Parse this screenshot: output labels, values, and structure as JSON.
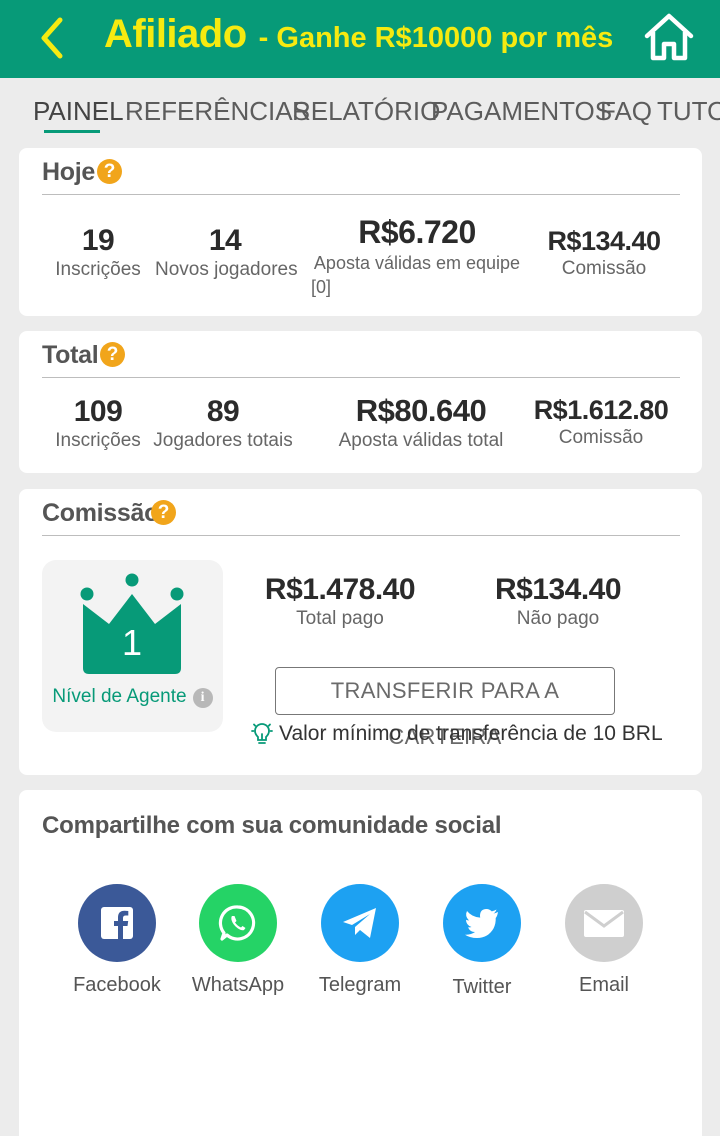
{
  "header": {
    "title": "Afiliado",
    "subtitle": "- Ganhe R$10000 por mês",
    "back_icon": "chevron-left-icon",
    "home_icon": "home-icon",
    "color": "#079a78",
    "title_color": "#f6ea10"
  },
  "tabs": [
    {
      "label": "PAINEL",
      "active": true
    },
    {
      "label": "REFERÊNCIAS"
    },
    {
      "label": "RELATÓRIO"
    },
    {
      "label": "PAGAMENTOS"
    },
    {
      "label": "FAQ"
    },
    {
      "label": "TUTO"
    }
  ],
  "today": {
    "title": "Hoje",
    "stats": [
      {
        "value": "19",
        "label": "Inscrições"
      },
      {
        "value": "14",
        "label": "Novos jogadores"
      },
      {
        "value": "R$6.720",
        "label": "Aposta válidas em equipe",
        "label2": "[0]"
      },
      {
        "value": "R$134.40",
        "label": "Comissão"
      }
    ]
  },
  "total": {
    "title": "Total",
    "stats": [
      {
        "value": "109",
        "label": "Inscrições"
      },
      {
        "value": "89",
        "label": "Jogadores totais"
      },
      {
        "value": "R$80.640",
        "label": "Aposta válidas total"
      },
      {
        "value": "R$1.612.80",
        "label": "Comissão"
      }
    ]
  },
  "commission": {
    "title": "Comissão",
    "agent_level": "1",
    "agent_label": "Nível de Agente",
    "paid_value": "R$1.478.40",
    "paid_label": "Total pago",
    "unpaid_value": "R$134.40",
    "unpaid_label": "Não pago",
    "transfer_button": "TRANSFERIR PARA A CARTEIRA",
    "min_note": "Valor mínimo de transferência de 10 BRL"
  },
  "share": {
    "title": "Compartilhe com sua comunidade social",
    "items": [
      {
        "label": "Facebook",
        "icon": "facebook-icon",
        "color": "#3b5998"
      },
      {
        "label": "WhatsApp",
        "icon": "whatsapp-icon",
        "color": "#25d366"
      },
      {
        "label": "Telegram",
        "icon": "telegram-icon",
        "color": "#1da1f2"
      },
      {
        "label": "Twitter",
        "icon": "twitter-icon",
        "color": "#1da1f2"
      },
      {
        "label": "Email",
        "icon": "email-icon",
        "color": "#cfcfcf"
      }
    ]
  }
}
